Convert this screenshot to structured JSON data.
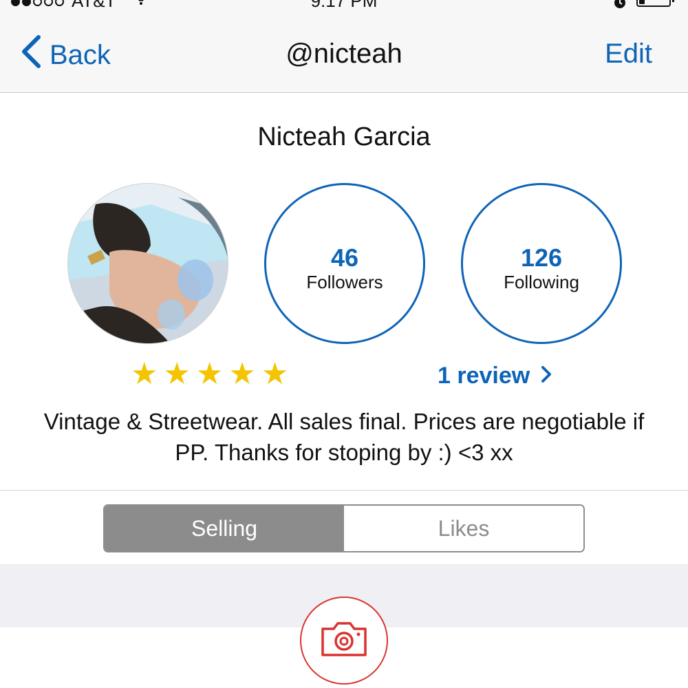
{
  "status_bar": {
    "carrier": "AT&T",
    "time": "9:17 PM",
    "signal_bars_filled": 2,
    "signal_bars_total": 5,
    "battery_level": 0.2,
    "icons": [
      "wifi-icon",
      "alarm-icon",
      "battery-icon"
    ]
  },
  "nav": {
    "back_label": "Back",
    "title": "@nicteah",
    "edit_label": "Edit",
    "back_icon": "chevron-left-icon"
  },
  "profile": {
    "name": "Nicteah Garcia",
    "followers_count": "46",
    "followers_label": "Followers",
    "following_count": "126",
    "following_label": "Following",
    "rating": 5,
    "rating_max": 5,
    "reviews_label": "1 review",
    "bio": "Vintage & Streetwear. All sales final. Prices are negotiable if PP. Thanks for stoping by :) <3 xx"
  },
  "segments": {
    "selling_label": "Selling",
    "likes_label": "Likes",
    "selected": "Selling"
  },
  "bottom": {
    "camera_icon": "camera-icon"
  },
  "colors": {
    "accent": "#0d64b7",
    "star": "#f4c400",
    "camera": "#d9322e",
    "segment_active": "#8c8c8c",
    "band": "#efeff4"
  }
}
